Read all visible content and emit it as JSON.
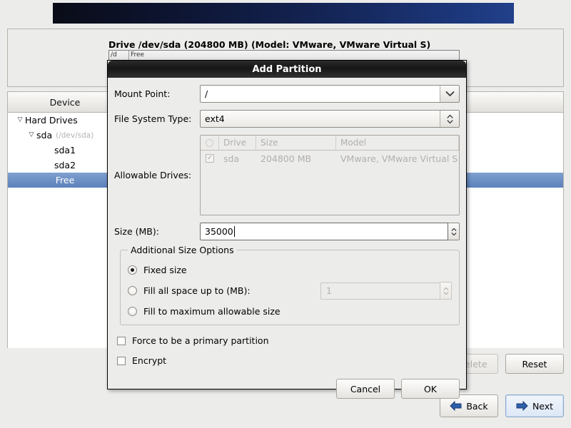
{
  "background": {
    "drive_label": "Drive /dev/sda (204800 MB) (Model: VMware, VMware Virtual S)",
    "partition_bar": {
      "segment1": "/d",
      "segment2": "Free"
    },
    "tree": {
      "header_device": "Device",
      "rows": [
        {
          "label": "Hard Drives",
          "detail": "",
          "twisty": "▽",
          "indent": 0,
          "selected": false
        },
        {
          "label": "sda",
          "detail": "(/dev/sda)",
          "twisty": "▽",
          "indent": 1,
          "selected": false
        },
        {
          "label": "sda1",
          "detail": "",
          "twisty": "",
          "indent": 2,
          "selected": false
        },
        {
          "label": "sda2",
          "detail": "",
          "twisty": "",
          "indent": 2,
          "selected": false
        },
        {
          "label": "Free",
          "detail": "",
          "twisty": "",
          "indent": 2,
          "selected": true
        }
      ]
    },
    "buttons": {
      "delete": "Delete",
      "reset": "Reset",
      "back": "Back",
      "next": "Next"
    },
    "colors": {
      "selection_blue": "#5c82bb",
      "banner_dark": "#0a0c17",
      "banner_blue": "#21408a",
      "arrow_blue": "#2c5fa8"
    }
  },
  "dialog": {
    "title": "Add Partition",
    "mount_point": {
      "label": "Mount Point:",
      "value": "/"
    },
    "file_system_type": {
      "label": "File System Type:",
      "value": "ext4"
    },
    "allowable_drives": {
      "label": "Allowable Drives:",
      "columns": [
        "",
        "Drive",
        "Size",
        "Model"
      ],
      "rows": [
        {
          "checked": "✓",
          "drive": "sda",
          "size": "204800 MB",
          "model": "VMware, VMware Virtual S"
        }
      ]
    },
    "size": {
      "label": "Size (MB):",
      "value": "35000"
    },
    "additional_size_options": {
      "legend": "Additional Size Options",
      "options": [
        {
          "label": "Fixed size",
          "selected": true
        },
        {
          "label": "Fill all space up to (MB):",
          "selected": false,
          "value": "1"
        },
        {
          "label": "Fill to maximum allowable size",
          "selected": false
        }
      ]
    },
    "checkboxes": [
      {
        "label": "Force to be a primary partition",
        "checked": false
      },
      {
        "label": "Encrypt",
        "checked": false
      }
    ],
    "buttons": {
      "cancel": "Cancel",
      "ok": "OK"
    }
  }
}
